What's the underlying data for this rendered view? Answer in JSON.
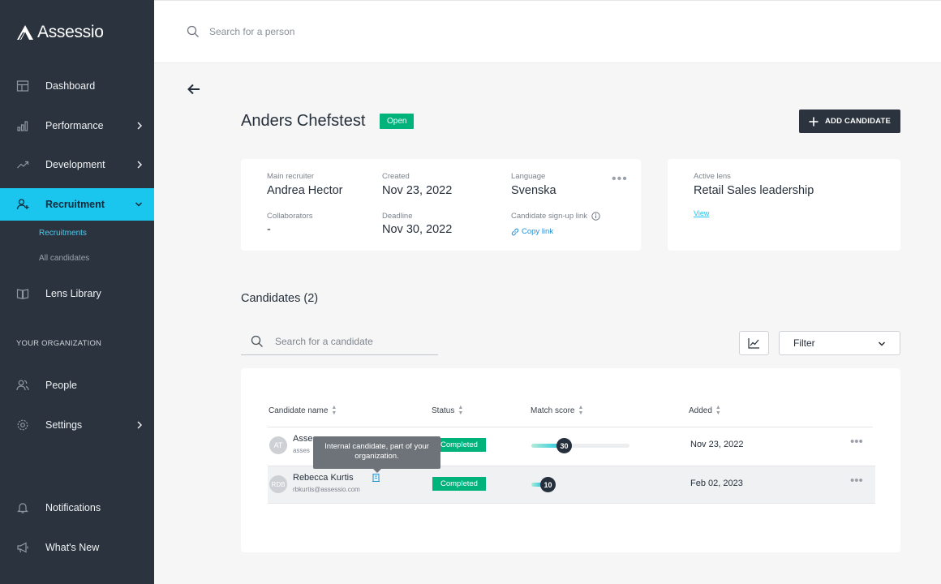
{
  "app": {
    "name": "Assessio",
    "accent": "#1ac6ee",
    "sidebar_bg": "#2b333e",
    "success": "#00b37a"
  },
  "sidebar": {
    "items": [
      {
        "label": "Dashboard",
        "icon": "dashboard-icon"
      },
      {
        "label": "Performance",
        "icon": "bar-chart-icon",
        "expandable": true
      },
      {
        "label": "Development",
        "icon": "trend-icon",
        "expandable": true
      },
      {
        "label": "Recruitment",
        "icon": "add-user-icon",
        "expanded": true,
        "active": true
      },
      {
        "label": "Lens Library",
        "icon": "book-icon"
      },
      {
        "label": "People",
        "icon": "people-icon"
      },
      {
        "label": "Settings",
        "icon": "gear-icon",
        "expandable": true
      },
      {
        "label": "Notifications",
        "icon": "bell-icon"
      },
      {
        "label": "What's New",
        "icon": "megaphone-icon"
      }
    ],
    "subitems": [
      {
        "label": "Recruitments",
        "active": true
      },
      {
        "label": "All candidates"
      }
    ],
    "section_label": "YOUR ORGANIZATION"
  },
  "top_search": {
    "placeholder": "Search for a person"
  },
  "recruitment": {
    "title": "Anders Chefstest",
    "status": "Open",
    "add_button": "ADD CANDIDATE",
    "main_recruiter_label": "Main recruiter",
    "main_recruiter": "Andrea Hector",
    "created_label": "Created",
    "created": "Nov 23, 2022",
    "language_label": "Language",
    "language": "Svenska",
    "collaborators_label": "Collaborators",
    "collaborators": "-",
    "deadline_label": "Deadline",
    "deadline": "Nov 30, 2022",
    "signup_label": "Candidate sign-up link",
    "copy_link": "Copy link",
    "active_lens_label": "Active lens",
    "active_lens": "Retail Sales leadership",
    "view_link": "View"
  },
  "candidates": {
    "title": "Candidates (2)",
    "search_placeholder": "Search for a candidate",
    "filter_label": "Filter",
    "columns": [
      "Candidate name",
      "Status",
      "Match score",
      "Added"
    ],
    "rows": [
      {
        "initials": "AT",
        "name": "Asse",
        "email": "asses",
        "status": "Completed",
        "score": 30,
        "added": "Nov 23, 2022"
      },
      {
        "initials": "RDB",
        "name": "Rebecca Kurtis",
        "email": "rbkurtis@assessio.com",
        "status": "Completed",
        "score": 10,
        "added": "Feb 02, 2023"
      }
    ],
    "tooltip": "Internal candidate, part of your organization."
  }
}
